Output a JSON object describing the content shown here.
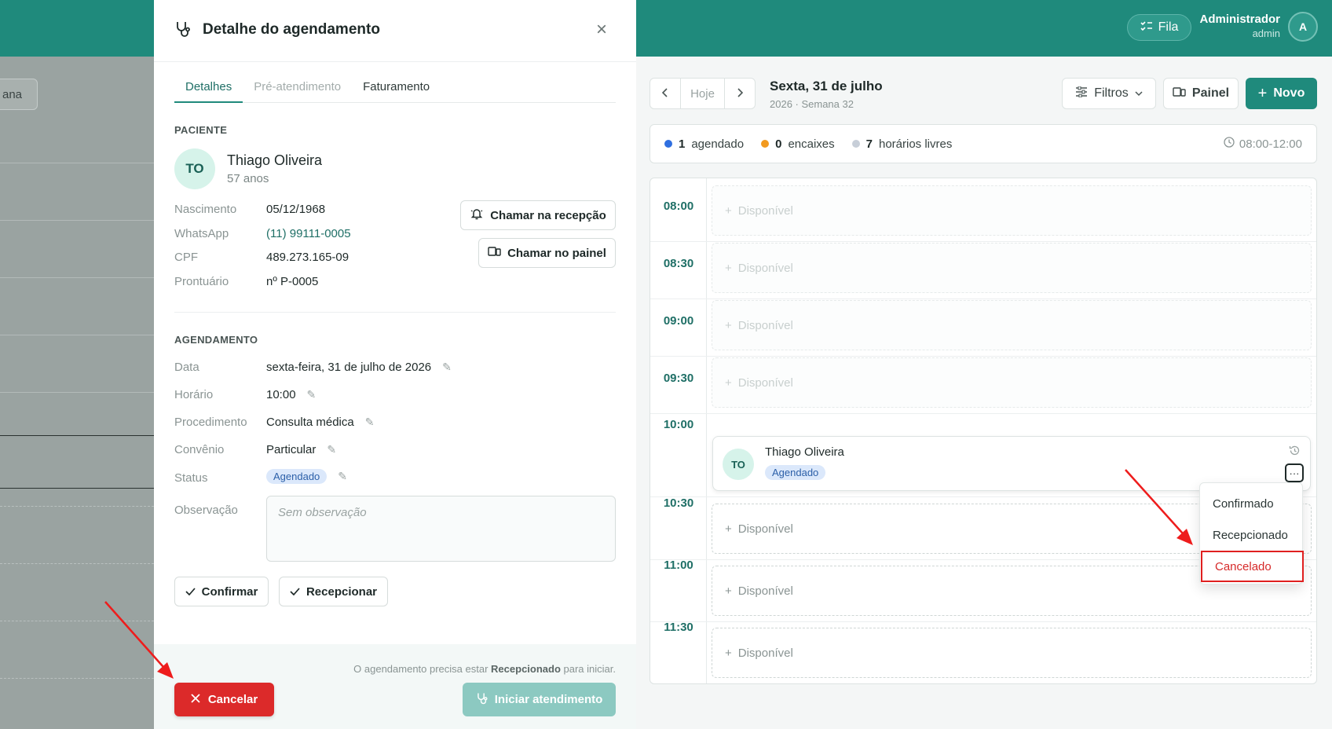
{
  "header": {
    "fila_label": "Fila",
    "user_name": "Administrador",
    "user_role": "admin",
    "avatar_initial": "A"
  },
  "background": {
    "semana_partial": "ana"
  },
  "modal": {
    "title": "Detalhe do agendamento",
    "close_icon": "×",
    "tabs": [
      "Detalhes",
      "Pré-atendimento",
      "Faturamento"
    ],
    "patient_section": "PACIENTE",
    "patient": {
      "initials": "TO",
      "name": "Thiago Oliveira",
      "age": "57 anos",
      "fields": [
        {
          "label": "Nascimento",
          "value": "05/12/1968"
        },
        {
          "label": "WhatsApp",
          "value": "(11) 99111-0005"
        },
        {
          "label": "CPF",
          "value": "489.273.165-09"
        },
        {
          "label": "Prontuário",
          "value": "nº P-0005"
        }
      ]
    },
    "call_reception": "Chamar na recepção",
    "call_panel": "Chamar no painel",
    "appointment_section": "AGENDAMENTO",
    "appointment": {
      "fields": [
        {
          "label": "Data",
          "value": "sexta-feira, 31 de julho de 2026"
        },
        {
          "label": "Horário",
          "value": "10:00"
        },
        {
          "label": "Procedimento",
          "value": "Consulta médica"
        },
        {
          "label": "Convênio",
          "value": "Particular"
        },
        {
          "label": "Status",
          "value": "Agendado"
        }
      ],
      "obs_label": "Observação",
      "obs_placeholder": "Sem observação"
    },
    "confirm_label": "Confirmar",
    "receive_label": "Recepcionar",
    "hint_prefix": "O agendamento precisa estar ",
    "hint_bold": "Recepcionado",
    "hint_suffix": " para iniciar.",
    "cancel_label": "Cancelar",
    "start_label": "Iniciar atendimento"
  },
  "schedule": {
    "today_label": "Hoje",
    "day_title": "Sexta, 31 de julho",
    "day_subtitle": "2026 · Semana 32",
    "filters_label": "Filtros",
    "panel_label": "Painel",
    "new_label": "Novo",
    "summary": [
      {
        "count": "1",
        "label": "agendado",
        "color": "#2f6fe0"
      },
      {
        "count": "0",
        "label": "encaixes",
        "color": "#f29a1f"
      },
      {
        "count": "7",
        "label": "horários livres",
        "color": "#c7ced8"
      }
    ],
    "range": "08:00-12:00",
    "slots": [
      {
        "time": "08:00",
        "label": "Disponível"
      },
      {
        "time": "08:30",
        "label": "Disponível"
      },
      {
        "time": "09:00",
        "label": "Disponível"
      },
      {
        "time": "09:30",
        "label": "Disponível"
      },
      {
        "time": "10:00",
        "label": ""
      },
      {
        "time": "10:30",
        "label": "Disponível"
      },
      {
        "time": "11:00",
        "label": "Disponível"
      },
      {
        "time": "11:30",
        "label": "Disponível"
      }
    ],
    "appointment_card": {
      "initials": "TO",
      "name": "Thiago Oliveira",
      "status": "Agendado",
      "more_icon": "···"
    },
    "status_menu": [
      "Confirmado",
      "Recepcionado",
      "Cancelado"
    ]
  }
}
